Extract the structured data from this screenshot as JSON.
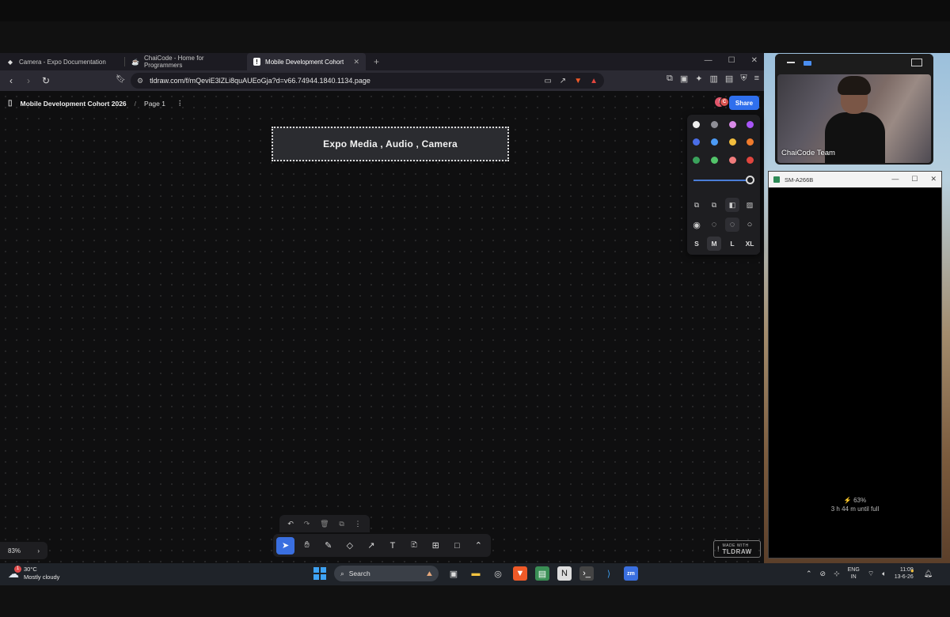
{
  "browser": {
    "tabs": [
      {
        "label": "Camera - Expo Documentation",
        "icon": "expo-icon",
        "active": false
      },
      {
        "label": "ChaiCode - Home for Programmers",
        "icon": "chaicode-icon",
        "active": false
      },
      {
        "label": "Mobile Development Cohort 20...",
        "icon": "tldraw-icon",
        "active": true
      }
    ],
    "url": "tldraw.com/f/mQeviE3lZLi8quAUEoGja?d=v66.74944.1840.1134.page"
  },
  "app": {
    "file_name": "Mobile Development Cohort 2026",
    "separator": "/",
    "page_name": "Page 1",
    "share_label": "Share",
    "avatars": [
      {
        "letter": "I",
        "color": "#e0556a"
      },
      {
        "letter": "C",
        "color": "#d9534f"
      }
    ],
    "canvas_text": "Expo Media , Audio , Camera",
    "zoom_level": "83%",
    "made_with_line1": "MADE WITH",
    "made_with_line2": "TLDRAW"
  },
  "style_panel": {
    "colors": [
      "#eeeeee",
      "#8e8e96",
      "#d98ae8",
      "#a855f7",
      "#4a6ee8",
      "#4c9bf5",
      "#f1bd3d",
      "#f07b2c",
      "#3aa25c",
      "#53c46a",
      "#f07c7c",
      "#e0453e"
    ],
    "selected_color": "#eeeeee",
    "sizes": [
      "S",
      "M",
      "L",
      "XL"
    ],
    "selected_size": "M",
    "opacity": 1.0
  },
  "webcam": {
    "name": "ChaiCode Team"
  },
  "phone_window": {
    "title": "SM-A266B",
    "battery_percent": "⚡ 63%",
    "battery_remaining": "3 h 44 m until full"
  },
  "taskbar": {
    "temperature": "30°C",
    "weather": "Mostly cloudy",
    "weather_badge": "1",
    "search_label": "Search",
    "lang_line1": "ENG",
    "lang_line2": "IN",
    "time": "11:09",
    "date": "13-6-26"
  }
}
